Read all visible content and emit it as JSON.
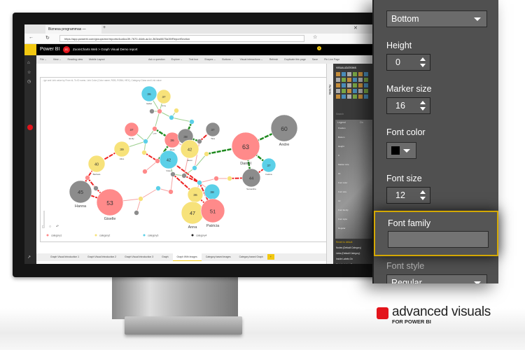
{
  "browser": {
    "tab_title": "Biznesa programmas —",
    "url": "https://app.powerbi.com/groups/me/reports/4ca6cc39-7670-44db-ac1e-363ea5675a39/ReportSection"
  },
  "powerbi": {
    "app_name": "Power BI",
    "avatar": "ZC",
    "breadcrumb": "ZoomCharts Web  >  Graph Visual Demo report",
    "notification_count": "1"
  },
  "toolbar": {
    "left": [
      "File ⌄",
      "View ⌄",
      "Reading view",
      "Mobile Layout"
    ],
    "right": [
      "Ask a question",
      "Explore ⌄",
      "Text box",
      "Shapes ⌄",
      "Buttons ⌄",
      "Visual interactions ⌄",
      "Refresh",
      "Duplicate this page",
      "Save",
      "Pin Live Page"
    ]
  },
  "visual": {
    "subtitle": "...ige and Link value by From id, To ID name, Link Color (Color name, RGB, RGBA, HEX), Category Class and Link value",
    "categories": [
      {
        "name": "category1",
        "color": "#ff8a8a"
      },
      {
        "name": "category2",
        "color": "#f7e27a"
      },
      {
        "name": "category3",
        "color": "#5bd0e8"
      },
      {
        "name": "category4",
        "color": "#222222"
      }
    ],
    "nodes": [
      {
        "v": "36",
        "l": "Isabel",
        "c": 2
      },
      {
        "v": "37",
        "l": "Amy",
        "c": 1
      },
      {
        "v": "",
        "l": "",
        "c": 3
      },
      {
        "v": "",
        "l": "",
        "c": 0
      },
      {
        "v": "",
        "l": "",
        "c": 1
      },
      {
        "v": "",
        "l": "",
        "c": 2
      },
      {
        "v": "",
        "l": "",
        "c": 2
      },
      {
        "v": "37",
        "l": "Emily",
        "c": 0
      },
      {
        "v": "",
        "l": "Lee",
        "c": 0
      },
      {
        "v": "36",
        "l": "Mark",
        "c": 0
      },
      {
        "v": "38",
        "l": "Robert",
        "c": 3
      },
      {
        "v": "",
        "l": "",
        "c": 3
      },
      {
        "v": "37",
        "l": "Tara",
        "c": 3
      },
      {
        "v": "42",
        "l": "Jason",
        "c": 1
      },
      {
        "v": "39",
        "l": "Alice",
        "c": 1
      },
      {
        "v": "",
        "l": "",
        "c": 2
      },
      {
        "v": "",
        "l": "",
        "c": 1
      },
      {
        "v": "40",
        "l": "Barbara",
        "c": 1
      },
      {
        "v": "42",
        "l": "Violet",
        "c": 2
      },
      {
        "v": "",
        "l": "",
        "c": 0
      },
      {
        "v": "",
        "l": "",
        "c": 0
      },
      {
        "v": "",
        "l": "",
        "c": 1
      },
      {
        "v": "",
        "l": "",
        "c": 3
      },
      {
        "v": "",
        "l": "",
        "c": 3
      },
      {
        "v": "",
        "l": "",
        "c": 2
      },
      {
        "v": "",
        "l": "",
        "c": 2
      },
      {
        "v": "",
        "l": "",
        "c": 0
      },
      {
        "v": "",
        "l": "",
        "c": 3
      },
      {
        "v": "45",
        "l": "Hanna",
        "c": 3
      },
      {
        "v": "53",
        "l": "Giselle",
        "c": 0
      },
      {
        "v": "",
        "l": "",
        "c": 1
      },
      {
        "v": "",
        "l": "",
        "c": 3
      },
      {
        "v": "",
        "l": "",
        "c": 2
      },
      {
        "v": "",
        "l": "",
        "c": 0
      },
      {
        "v": "36",
        "l": "Sofia",
        "c": 1
      },
      {
        "v": "38",
        "l": "Laura",
        "c": 2
      },
      {
        "v": "47",
        "l": "Anna",
        "c": 1
      },
      {
        "v": "51",
        "l": "Patricia",
        "c": 0
      },
      {
        "v": "",
        "l": "",
        "c": 0
      },
      {
        "v": "63",
        "l": "Daniel",
        "c": 0
      },
      {
        "v": "60",
        "l": "Andre",
        "c": 3
      },
      {
        "v": "37",
        "l": "Fatima",
        "c": 2
      },
      {
        "v": "44",
        "l": "Samantha",
        "c": 3
      },
      {
        "v": "",
        "l": "",
        "c": 1
      }
    ]
  },
  "page_tabs": [
    "Graph Visual Introduction 1",
    "Graph Visual Introduction 2",
    "Graph Visual Introduction 3",
    "Graph",
    "Graph With Images",
    "Category based images",
    "Category based Graph",
    "+"
  ],
  "active_tab": "Graph With Images",
  "filters_label": "FILTERS",
  "visualizations": {
    "title": "VISUALIZATIONS",
    "search": "Search",
    "legend": "Legend",
    "legend_toggle": "On",
    "mini": [
      "Position",
      "Bottom",
      "Height",
      "0",
      "Marker size",
      "16",
      "Font color",
      "Font size",
      "12",
      "Font family",
      "Font style",
      "Regular"
    ],
    "sections": [
      "Revert to default",
      "Nodes (Default Category)",
      "Links (Default Category)",
      "Inside Labels  On",
      "Outside Lab...  On"
    ]
  },
  "format_panel": {
    "position_value": "Bottom",
    "height_label": "Height",
    "height_value": "0",
    "marker_size_label": "Marker size",
    "marker_size_value": "16",
    "font_color_label": "Font color",
    "font_color_value": "#000000",
    "font_size_label": "Font size",
    "font_size_value": "12",
    "font_family_label": "Font family",
    "font_family_value": "",
    "font_style_label": "Font style",
    "font_style_value": "Regular",
    "highlight_color": "#d4a800"
  },
  "brand": {
    "name": "advanced visuals",
    "tagline": "FOR POWER BI"
  }
}
